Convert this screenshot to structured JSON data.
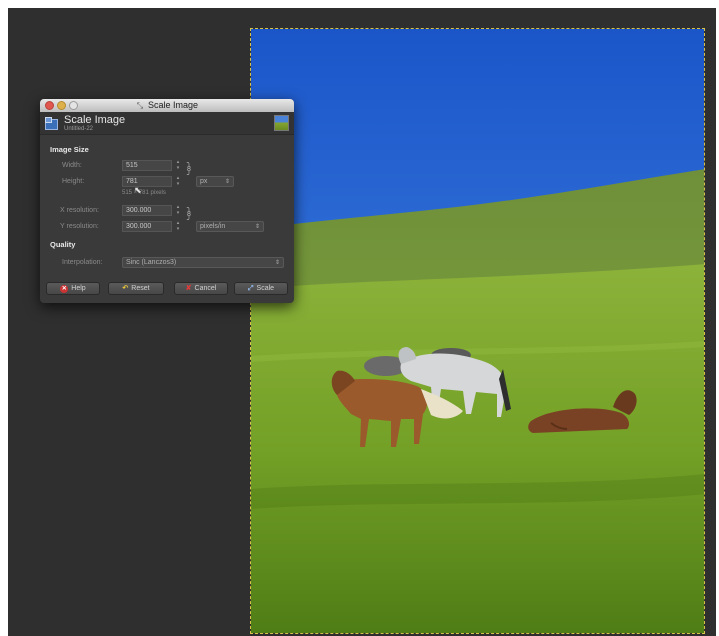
{
  "window": {
    "title": "Scale Image"
  },
  "header": {
    "title": "Scale Image",
    "subtitle": "Untitled-22"
  },
  "image_size": {
    "heading": "Image Size",
    "width_label": "Width:",
    "width_value": "515",
    "height_label": "Height:",
    "height_value": "781",
    "pixel_info": "515 × 781 pixels",
    "unit": "px",
    "x_res_label": "X resolution:",
    "x_res_value": "300.000",
    "y_res_label": "Y resolution:",
    "y_res_value": "300.000",
    "res_unit": "pixels/in"
  },
  "quality": {
    "heading": "Quality",
    "interp_label": "Interpolation:",
    "interp_value": "Sinc (Lanczos3)"
  },
  "buttons": {
    "help": "Help",
    "reset": "Reset",
    "cancel": "Cancel",
    "scale": "Scale"
  },
  "icons": {
    "close": "close-light-icon",
    "minimize": "minimize-light-icon",
    "maximize": "maximize-light-icon",
    "scale": "scale-image-icon",
    "chain": "chain-link-icon",
    "help": "help-icon",
    "reset": "reset-icon",
    "cancel": "cancel-icon",
    "cursor": "cursor-icon"
  },
  "colors": {
    "workspace": "#2f2f2f",
    "dialog": "#3a3a3a",
    "sky": "#2f6fd6",
    "grass": "#6b9a22",
    "selection": "#d8c24a"
  }
}
